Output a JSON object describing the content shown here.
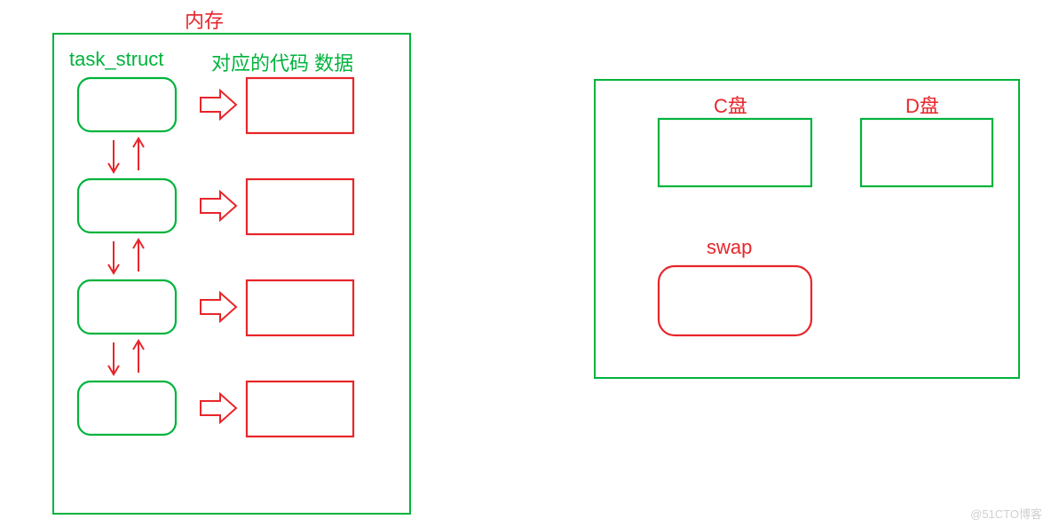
{
  "memory": {
    "title": "内存",
    "task_struct_label": "task_struct",
    "code_data_label": "对应的代码 数据"
  },
  "disk": {
    "c_drive": "C盘",
    "d_drive": "D盘",
    "swap": "swap"
  },
  "watermark": "@51CTO博客"
}
